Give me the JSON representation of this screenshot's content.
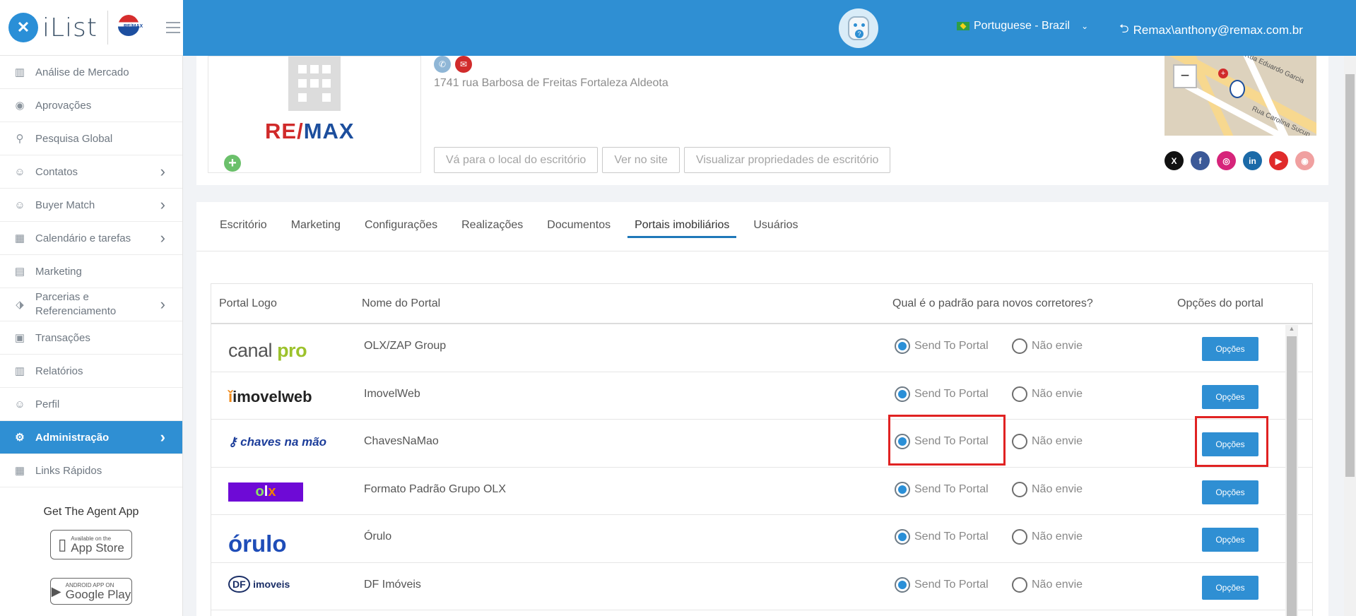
{
  "brand": {
    "name": "iList",
    "mark": "✕",
    "badge_text": "RE/MAX"
  },
  "topbar": {
    "language": "Portuguese - Brazil",
    "user": "Remax\\anthony@remax.com.br"
  },
  "sidebar": {
    "items": [
      {
        "label": "Análise de Mercado",
        "icon": "chart-icon",
        "arrow": false
      },
      {
        "label": "Aprovações",
        "icon": "eye-icon",
        "arrow": false
      },
      {
        "label": "Pesquisa Global",
        "icon": "search-icon",
        "arrow": false
      },
      {
        "label": "Contatos",
        "icon": "user-icon",
        "arrow": true
      },
      {
        "label": "Buyer Match",
        "icon": "user-icon",
        "arrow": true
      },
      {
        "label": "Calendário e tarefas",
        "icon": "calendar-icon",
        "arrow": true
      },
      {
        "label": "Marketing",
        "icon": "book-icon",
        "arrow": false
      },
      {
        "label": "Parcerias e Referenciamento",
        "icon": "handshake-icon",
        "arrow": true
      },
      {
        "label": "Transações",
        "icon": "briefcase-icon",
        "arrow": false
      },
      {
        "label": "Relatórios",
        "icon": "chart-icon",
        "arrow": false
      },
      {
        "label": "Perfil",
        "icon": "user-icon",
        "arrow": false
      },
      {
        "label": "Administração",
        "icon": "gear-icon",
        "arrow": true,
        "active": true
      },
      {
        "label": "Links Rápidos",
        "icon": "building-icon",
        "arrow": false
      }
    ],
    "app_title": "Get The Agent App",
    "app_store": {
      "small": "Available on the",
      "big": "App Store"
    },
    "google_play": {
      "small": "ANDROID APP ON",
      "big": "Google Play"
    }
  },
  "office": {
    "logo_text_red": "RE/",
    "logo_text_blue": "MAX",
    "address": "1741 rua Barbosa de Freitas Fortaleza Aldeota",
    "buttons": [
      "Vá para o local do escritório",
      "Ver no site",
      "Visualizar propriedades de escritório"
    ],
    "map_labels": [
      "Rua Eduardo Garcia",
      "Rua Carolina Sucup"
    ],
    "zoom_out": "−"
  },
  "socials": [
    {
      "name": "x-icon",
      "glyph": "X",
      "color": "#111111"
    },
    {
      "name": "facebook-icon",
      "glyph": "f",
      "color": "#3b5998"
    },
    {
      "name": "instagram-icon",
      "glyph": "◎",
      "color": "#d6247a"
    },
    {
      "name": "linkedin-icon",
      "glyph": "in",
      "color": "#1b6aa8"
    },
    {
      "name": "youtube-icon",
      "glyph": "▶",
      "color": "#e02b2b"
    },
    {
      "name": "weibo-icon",
      "glyph": "◉",
      "color": "#f0a0a0"
    }
  ],
  "tabs": [
    "Escritório",
    "Marketing",
    "Configurações",
    "Realizações",
    "Documentos",
    "Portais imobiliários",
    "Usuários"
  ],
  "active_tab": "Portais imobiliários",
  "table": {
    "headers": [
      "Portal Logo",
      "Nome do Portal",
      "Qual é o padrão para novos corretores?",
      "Opções do portal"
    ],
    "send_label": "Send To Portal",
    "nosend_label": "Não envie",
    "options_label": "Opções",
    "rows": [
      {
        "logo": "canal pro",
        "name": "OLX/ZAP Group",
        "selected": "send"
      },
      {
        "logo": "imovelweb",
        "name": "ImovelWeb",
        "selected": "send"
      },
      {
        "logo": "chaves na mão",
        "name": "ChavesNaMao",
        "selected": "send",
        "highlight": true
      },
      {
        "logo": "olx",
        "name": "Formato Padrão Grupo OLX",
        "selected": "send"
      },
      {
        "logo": "orulo",
        "name": "Órulo",
        "selected": "send"
      },
      {
        "logo": "DF imoveis",
        "name": "DF Imóveis",
        "selected": "send"
      }
    ]
  },
  "colors": {
    "primary": "#2f8fd3",
    "highlight": "#e02222",
    "remax_red": "#d02a2a",
    "remax_blue": "#1c4e9d"
  }
}
